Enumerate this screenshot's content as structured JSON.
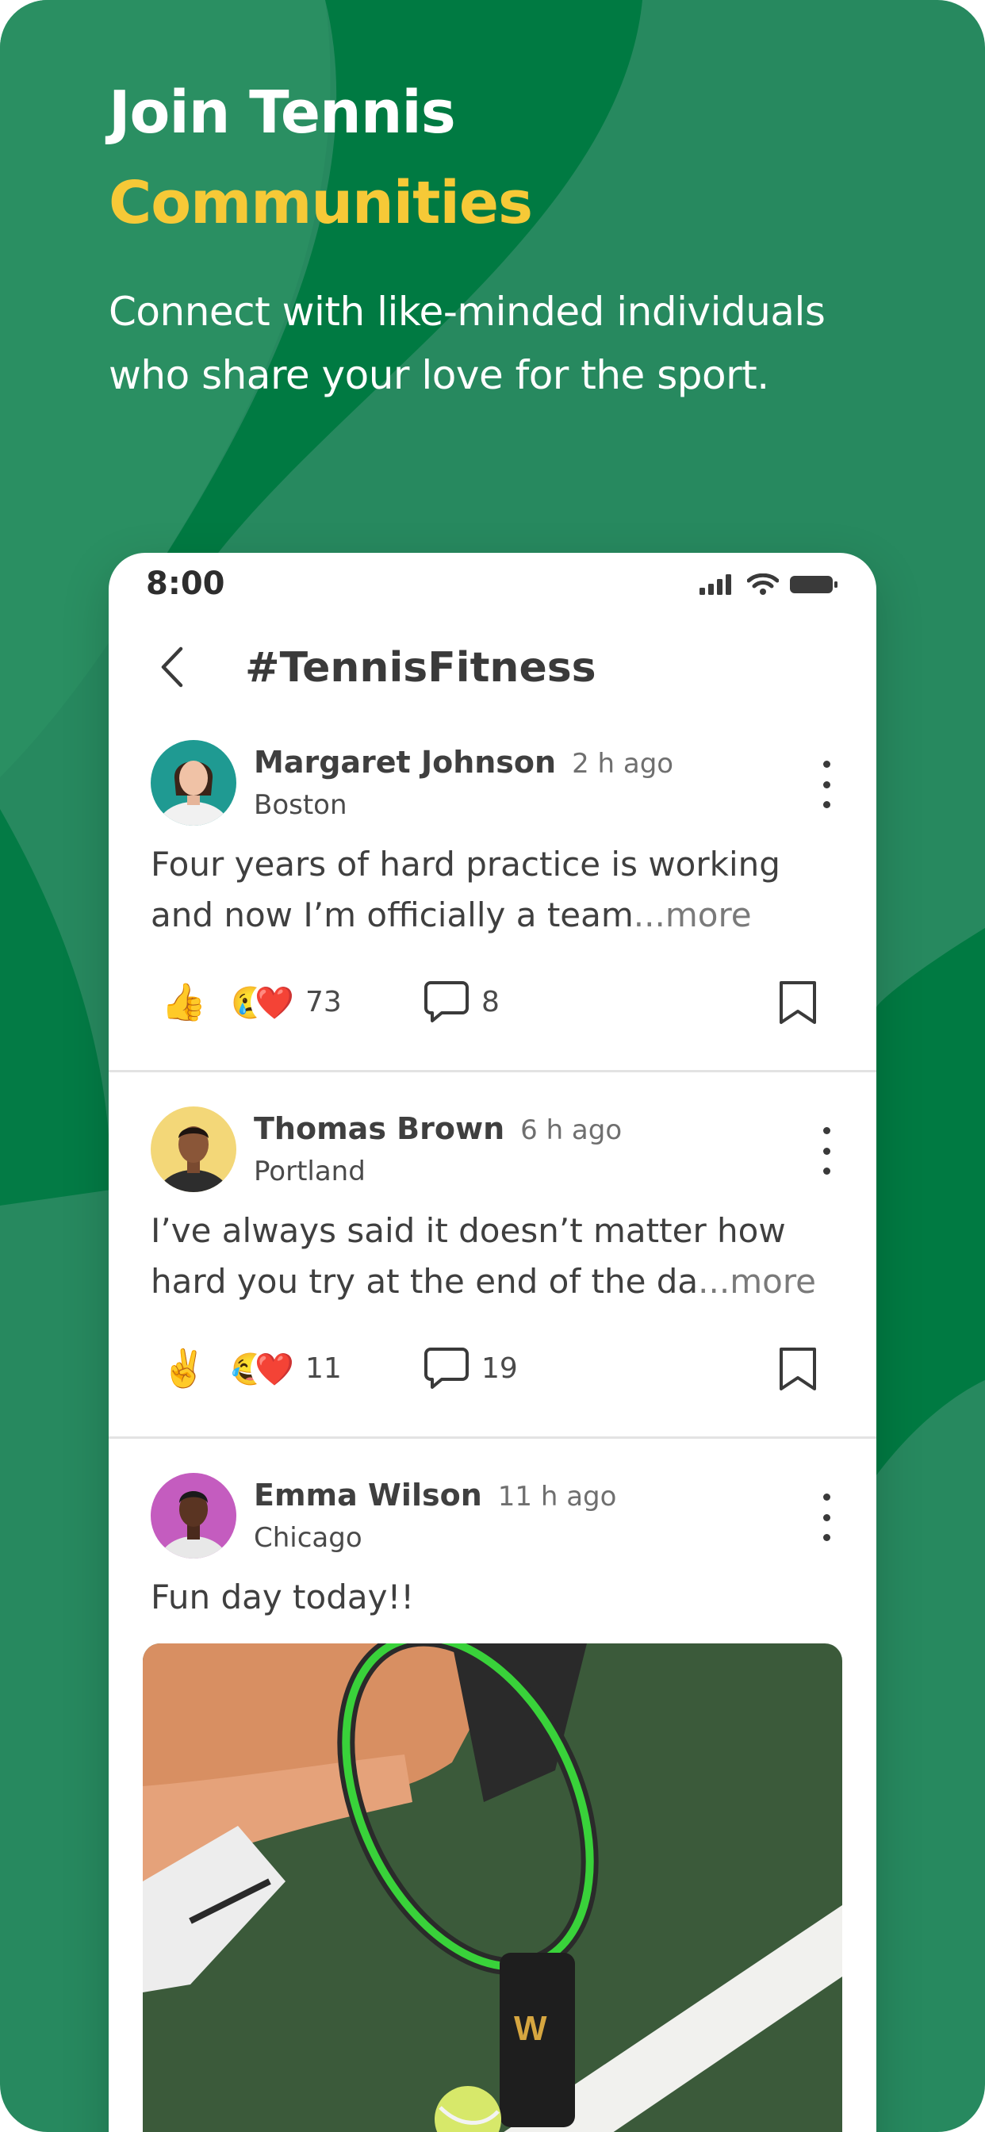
{
  "hero": {
    "title_line1": "Join Tennis",
    "title_line2": "Communities",
    "subtitle": "Connect with like-minded individuals who share your love for the sport."
  },
  "phone": {
    "status_time": "8:00",
    "nav_title": "#TennisFitness"
  },
  "posts": [
    {
      "author": "Margaret Johnson",
      "time_ago": "2 h ago",
      "location": "Boston",
      "text": "Four years of hard practice is working and now I’m officially a team",
      "more": "...more",
      "reaction_emoji": "👍",
      "reactions": [
        "😢",
        "❤️"
      ],
      "reaction_count": "73",
      "comment_count": "8"
    },
    {
      "author": "Thomas  Brown",
      "time_ago": "6 h ago",
      "location": "Portland",
      "text": "I’ve always said it doesn’t matter how hard you try at the end of the da",
      "more": "...more",
      "reaction_emoji": "✌️",
      "reactions": [
        "😂",
        "❤️"
      ],
      "reaction_count": "11",
      "comment_count": "19"
    },
    {
      "author": "Emma  Wilson",
      "time_ago": "11 h ago",
      "location": "Chicago",
      "text": "Fun day today!!",
      "photo_brand": "W"
    }
  ],
  "colors": {
    "background": "#27895f",
    "background_dark": "#007a42",
    "accent_yellow": "#f6c937",
    "card": "#ffffff"
  }
}
